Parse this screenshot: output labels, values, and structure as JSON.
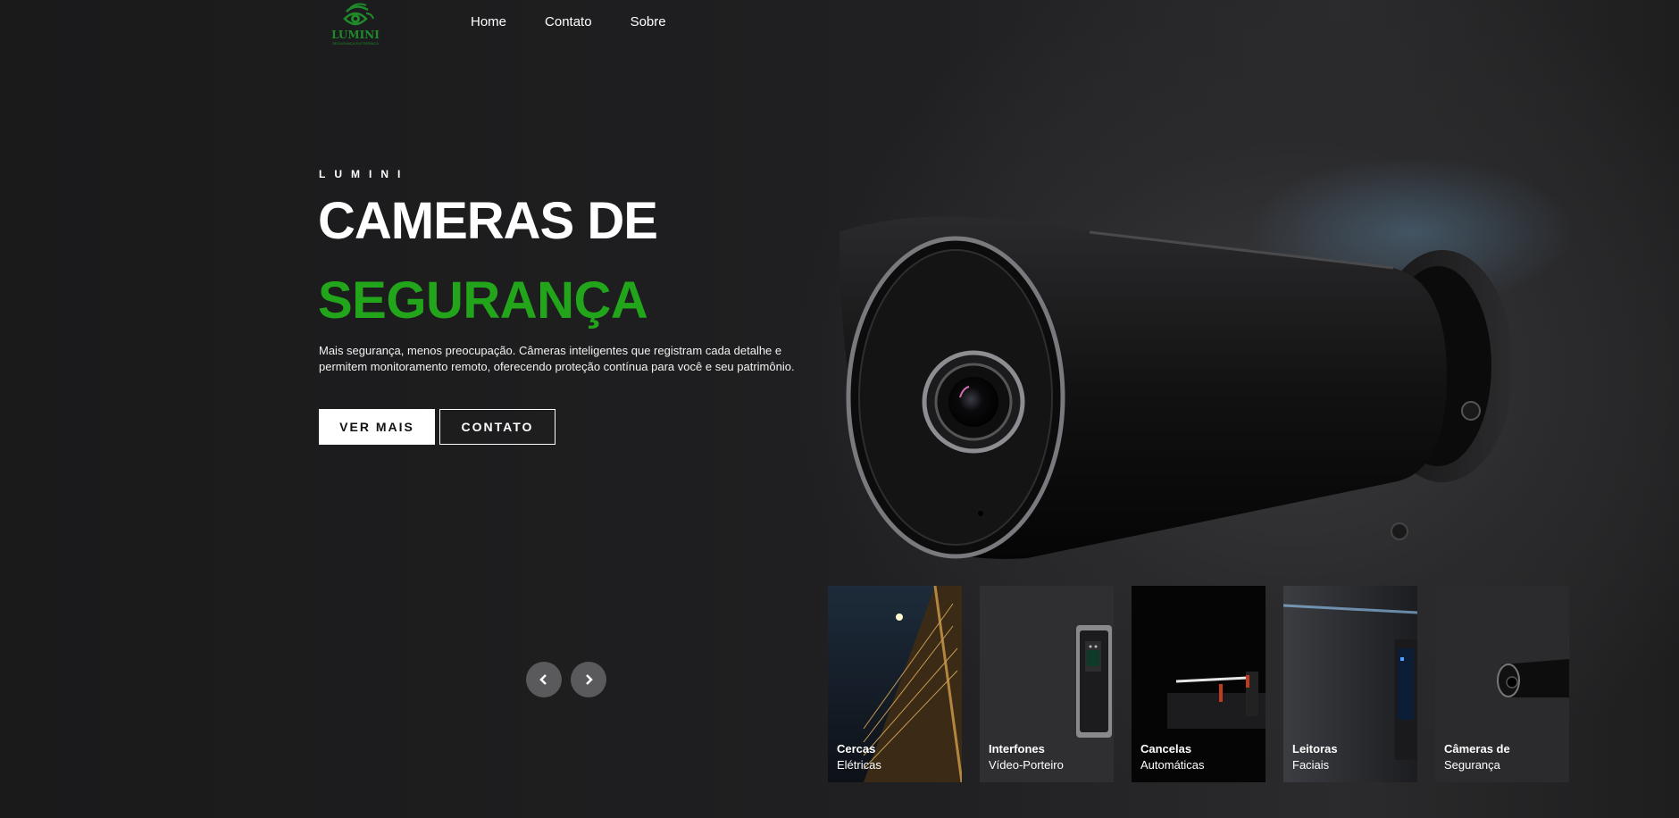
{
  "header": {
    "logo_text": "LUMINI",
    "logo_subtext": "SEGURANÇA ELETRÔNICA",
    "nav": [
      "Home",
      "Contato",
      "Sobre"
    ]
  },
  "hero": {
    "eyebrow": "LUMINI",
    "title_line1": "CAMERAS DE",
    "title_line2": "SEGURANÇA",
    "description": "Mais segurança, menos preocupação. Câmeras inteligentes que registram cada detalhe e permitem monitoramento remoto, oferecendo proteção contínua para você e seu patrimônio.",
    "button_primary": "VER MAIS",
    "button_secondary": "CONTATO"
  },
  "carousel": {
    "prev_icon": "chevron-left-icon",
    "next_icon": "chevron-right-icon",
    "cards": [
      {
        "title": "Cercas",
        "subtitle": "Elétricas"
      },
      {
        "title": "Interfones",
        "subtitle": "Vídeo-Porteiro"
      },
      {
        "title": "Cancelas",
        "subtitle": "Automáticas"
      },
      {
        "title": "Leitoras",
        "subtitle": "Faciais"
      },
      {
        "title": "Câmeras de",
        "subtitle": "Segurança"
      }
    ]
  },
  "colors": {
    "accent_green": "#22a51a",
    "logo_green": "#1f8a2a",
    "background": "#1b1b1c"
  }
}
